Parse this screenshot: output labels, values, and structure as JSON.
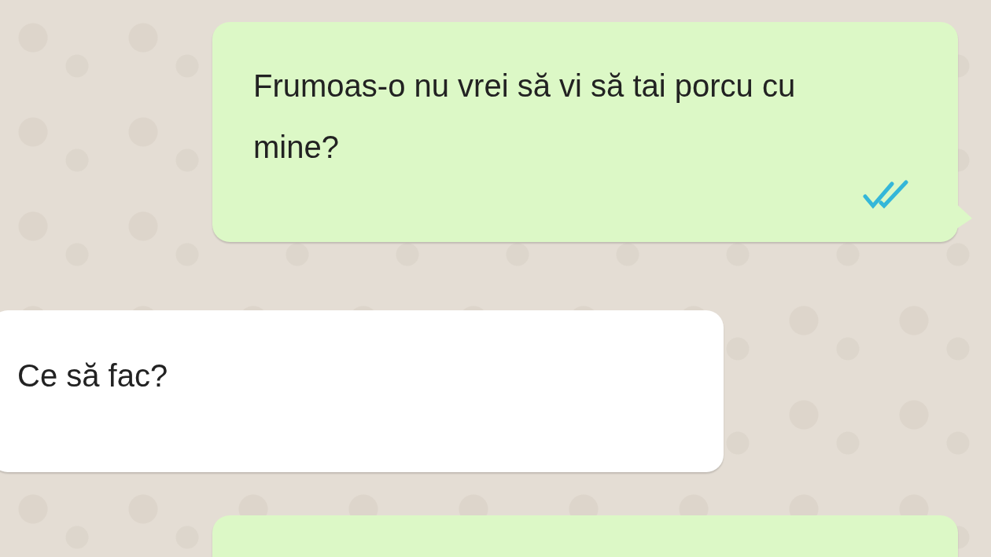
{
  "messages": [
    {
      "kind": "outgoing",
      "text": "Frumoas-o nu vrei să vi să tai porcu cu mine?",
      "read": true
    },
    {
      "kind": "incoming",
      "text": "Ce să fac?"
    },
    {
      "kind": "outgoing"
    }
  ]
}
